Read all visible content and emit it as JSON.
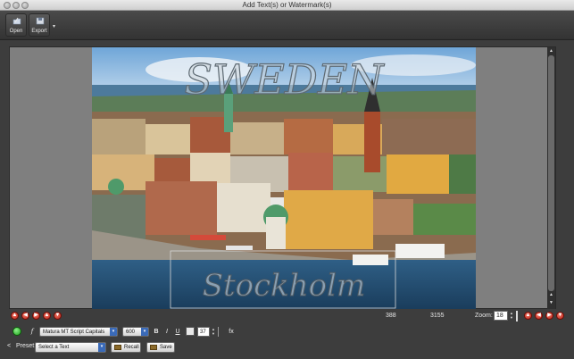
{
  "window": {
    "title": "Add Text(s) or Watermark(s)"
  },
  "toolbar": {
    "open_label": "Open",
    "export_label": "Export"
  },
  "canvas": {
    "watermark_top": "SWEDEN",
    "watermark_bottom": "Stockholm"
  },
  "status": {
    "coord_x": "388",
    "coord_y": "3155",
    "zoom_label": "Zoom:",
    "zoom_value": "18"
  },
  "format": {
    "italic_f": "f",
    "font": "Matura MT Script Capitals",
    "size": "600",
    "bold": "B",
    "italic": "I",
    "underline": "U",
    "opacity": "37",
    "fx": "fx"
  },
  "preset": {
    "arrow": "<",
    "label": "Preset:",
    "select_placeholder": "Select a Text",
    "recall_label": "Recall",
    "save_label": "Save"
  }
}
